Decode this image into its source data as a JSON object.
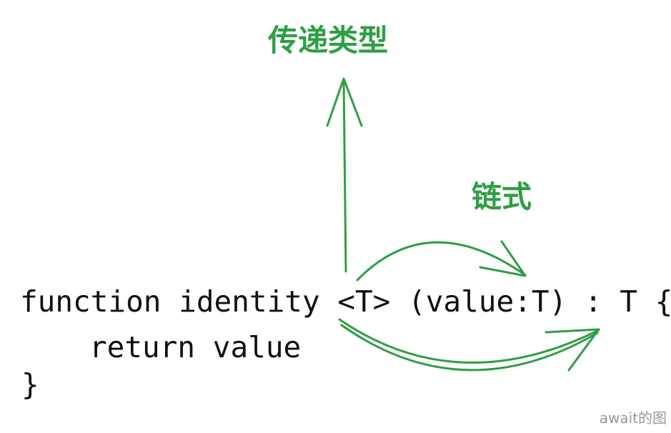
{
  "labels": {
    "pass_type": "传递类型",
    "chain": "链式"
  },
  "code": {
    "line1": "function identity <T> (value:T) : T {",
    "line2": "return value",
    "line3": "}"
  },
  "watermark": "await的图",
  "colors": {
    "accent": "#2f9e44",
    "text": "#111111",
    "background": "#ffffff",
    "watermark": "#9a9a9a"
  }
}
